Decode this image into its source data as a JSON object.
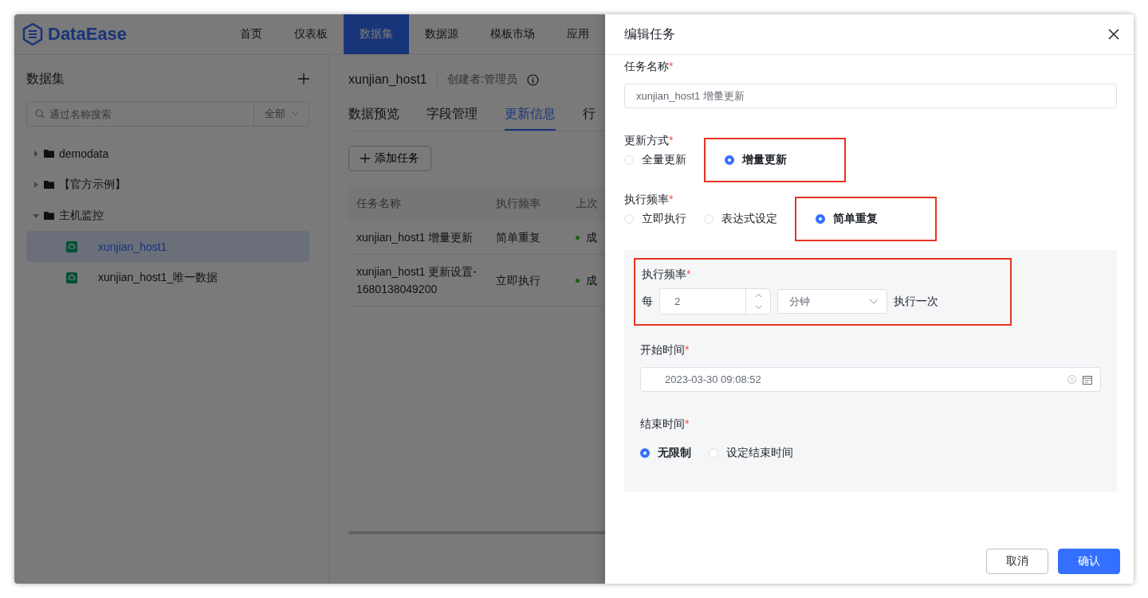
{
  "header": {
    "logo": "DataEase",
    "nav": [
      {
        "label": "首页",
        "selected": false
      },
      {
        "label": "仪表板",
        "selected": false
      },
      {
        "label": "数据集",
        "selected": true
      },
      {
        "label": "数据源",
        "selected": false
      },
      {
        "label": "模板市场",
        "selected": false
      },
      {
        "label": "应用",
        "selected": false
      }
    ]
  },
  "sidebar": {
    "title": "数据集",
    "search": {
      "placeholder": "通过名称搜索"
    },
    "filter": "全部",
    "tree": [
      {
        "label": "demodata",
        "kind": "folder",
        "expanded": false
      },
      {
        "label": "【官方示例】",
        "kind": "folder",
        "expanded": false
      },
      {
        "label": "主机监控",
        "kind": "folder",
        "expanded": true,
        "children": [
          {
            "label": "xunjian_host1",
            "kind": "dataset",
            "selected": true
          },
          {
            "label": "xunjian_host1_唯一数据",
            "kind": "dataset",
            "selected": false
          }
        ]
      }
    ]
  },
  "dataset": {
    "title": "xunjian_host1",
    "creator": "创建者:管理员",
    "tabs": [
      {
        "label": "数据预览",
        "selected": false
      },
      {
        "label": "字段管理",
        "selected": false
      },
      {
        "label": "更新信息",
        "selected": true
      },
      {
        "label": "行",
        "selected": false
      }
    ],
    "add_button": "添加任务",
    "table": {
      "columns": [
        "任务名称",
        "执行频率",
        "上次"
      ],
      "rows": [
        {
          "cells": [
            "xunjian_host1 增量更新",
            "简单重复",
            "成"
          ]
        },
        {
          "cells": [
            "xunjian_host1 更新设置-1680138049200",
            "立即执行",
            "成"
          ]
        }
      ]
    }
  },
  "drawer": {
    "title": "编辑任务",
    "task_name": {
      "label": "任务名称",
      "required_mark": "*",
      "value": "xunjian_host1 增量更新"
    },
    "update_mode": {
      "label": "更新方式",
      "required_mark": "*",
      "options": [
        {
          "label": "全量更新",
          "selected": false,
          "highlight": false
        },
        {
          "label": "增量更新",
          "selected": true,
          "highlight": true
        }
      ]
    },
    "frequency": {
      "label": "执行频率",
      "required_mark": "*",
      "options": [
        {
          "label": "立即执行",
          "selected": false,
          "highlight": false
        },
        {
          "label": "表达式设定",
          "selected": false,
          "highlight": false
        },
        {
          "label": "简单重复",
          "selected": true,
          "highlight": true
        }
      ]
    },
    "panel": {
      "repeat": {
        "label": "执行频率",
        "required_mark": "*",
        "highlight": true,
        "prefix": "每",
        "value": "2",
        "unit": "分钟",
        "suffix": "执行一次"
      },
      "start_time": {
        "label": "开始时间",
        "required_mark": "*",
        "value": "2023-03-30 09:08:52"
      },
      "end_time": {
        "label": "结束时间",
        "required_mark": "*",
        "options": [
          {
            "label": "无限制",
            "selected": true
          },
          {
            "label": "设定结束时间",
            "selected": false
          }
        ]
      }
    },
    "buttons": [
      {
        "label": "取消",
        "kind": "secondary"
      },
      {
        "label": "确认",
        "kind": "primary"
      }
    ]
  }
}
